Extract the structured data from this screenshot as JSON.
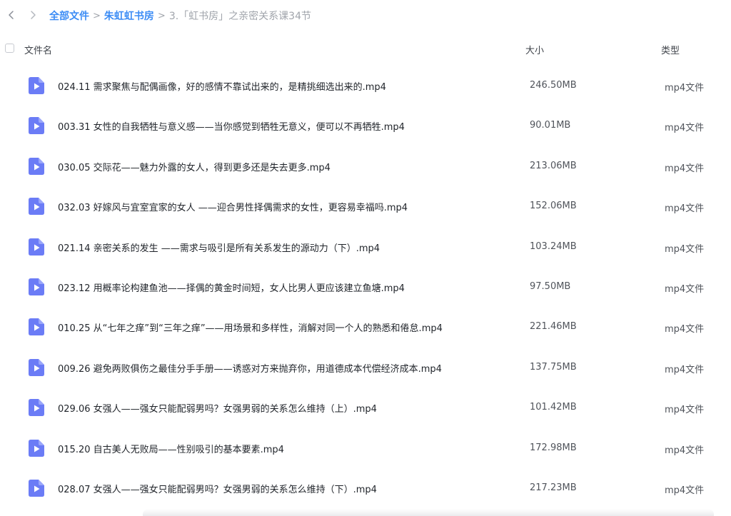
{
  "breadcrumb": {
    "root": "全部文件",
    "parent": "朱虹虹书房",
    "current": "3.「虹书房」之亲密关系课34节",
    "separator": ">"
  },
  "header": {
    "name": "文件名",
    "size": "大小",
    "type": "类型"
  },
  "icons": {
    "back": "chevron-left-icon",
    "forward": "chevron-right-icon",
    "file": "video-file-icon"
  },
  "colors": {
    "link": "#3b8cf5",
    "file_icon": "#6b7cf6"
  },
  "files": [
    {
      "name": "024.11 需求聚焦与配偶画像，好的感情不靠试出来的，是精挑细选出来的.mp4",
      "size": "246.50MB",
      "type": "mp4文件"
    },
    {
      "name": "003.31 女性的自我牺牲与意义感——当你感觉到牺牲无意义，便可以不再牺牲.mp4",
      "size": "90.01MB",
      "type": "mp4文件"
    },
    {
      "name": "030.05 交际花——魅力外露的女人，得到更多还是失去更多.mp4",
      "size": "213.06MB",
      "type": "mp4文件"
    },
    {
      "name": "032.03 好嫁风与宜室宜家的女人 ——迎合男性择偶需求的女性，更容易幸福吗.mp4",
      "size": "152.06MB",
      "type": "mp4文件"
    },
    {
      "name": "021.14 亲密关系的发生 ——需求与吸引是所有关系发生的源动力（下）.mp4",
      "size": "103.24MB",
      "type": "mp4文件"
    },
    {
      "name": "023.12 用概率论构建鱼池——择偶的黄金时间短，女人比男人更应该建立鱼塘.mp4",
      "size": "97.50MB",
      "type": "mp4文件"
    },
    {
      "name": "010.25 从“七年之痒”到“三年之痒”——用场景和多样性，消解对同一个人的熟悉和倦怠.mp4",
      "size": "221.46MB",
      "type": "mp4文件"
    },
    {
      "name": "009.26 避免两败俱伤之最佳分手手册——诱惑对方来抛弃你，用道德成本代偿经济成本.mp4",
      "size": "137.75MB",
      "type": "mp4文件"
    },
    {
      "name": "029.06 女强人——强女只能配弱男吗？女强男弱的关系怎么维持（上）.mp4",
      "size": "101.42MB",
      "type": "mp4文件"
    },
    {
      "name": "015.20 自古美人无败局——性别吸引的基本要素.mp4",
      "size": "172.98MB",
      "type": "mp4文件"
    },
    {
      "name": "028.07 女强人——强女只能配弱男吗？女强男弱的关系怎么维持（下）.mp4",
      "size": "217.23MB",
      "type": "mp4文件"
    }
  ]
}
